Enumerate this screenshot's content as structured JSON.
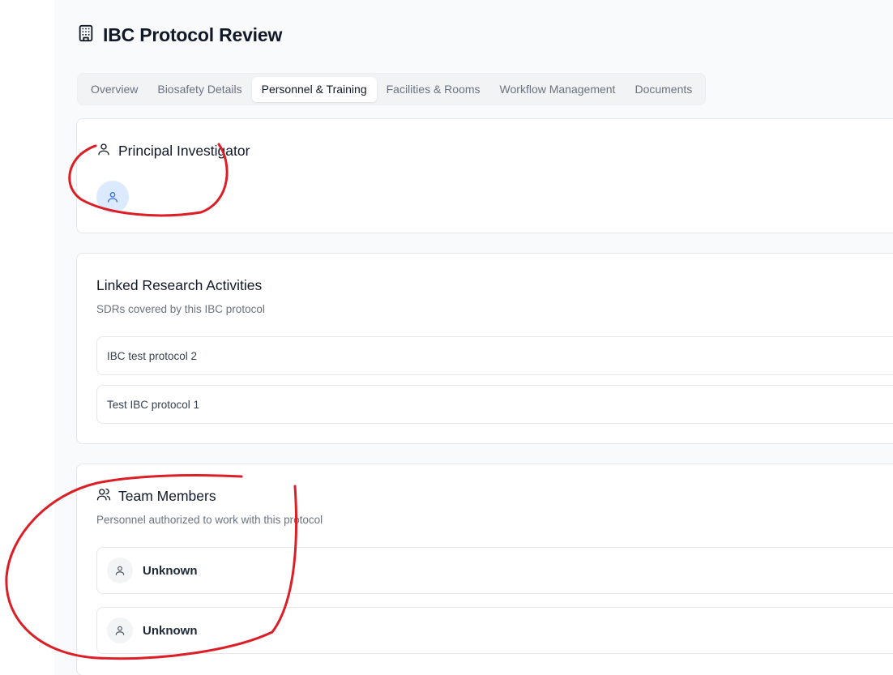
{
  "page": {
    "title": "IBC Protocol Review",
    "title_icon": "building-icon"
  },
  "tabs": [
    {
      "label": "Overview",
      "active": false
    },
    {
      "label": "Biosafety Details",
      "active": false
    },
    {
      "label": "Personnel & Training",
      "active": true
    },
    {
      "label": "Facilities & Rooms",
      "active": false
    },
    {
      "label": "Workflow Management",
      "active": false
    },
    {
      "label": "Documents",
      "active": false
    }
  ],
  "principal_investigator": {
    "title": "Principal Investigator",
    "icon": "user-icon",
    "avatar_icon": "user-icon"
  },
  "linked_research": {
    "title": "Linked Research Activities",
    "subtitle": "SDRs covered by this IBC protocol",
    "items": [
      "IBC test protocol 2",
      "Test IBC protocol 1"
    ]
  },
  "team_members": {
    "title": "Team Members",
    "subtitle": "Personnel authorized to work with this protocol",
    "icon": "users-icon",
    "members": [
      {
        "name": "Unknown"
      },
      {
        "name": "Unknown"
      }
    ]
  },
  "colors": {
    "annotation": "#dc1f26",
    "avatar_blue_bg": "#dbeafe",
    "avatar_blue_fg": "#3b6fd8"
  }
}
